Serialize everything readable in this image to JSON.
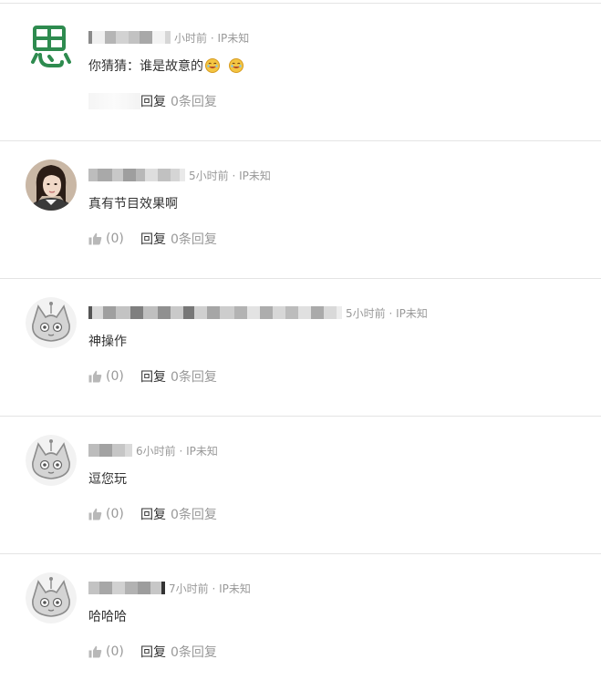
{
  "comments": [
    {
      "avatar": "si-character-icon",
      "time_ip": "小时前 · IP未知",
      "text": "你猜猜：谁是故意的",
      "emojis": [
        "laughing-emoji",
        "laughing-emoji"
      ],
      "like_count": "",
      "reply_label": "回复",
      "reply_count": "0条回复"
    },
    {
      "avatar": "woman-photo",
      "time_ip": "5小时前 · IP未知",
      "text": "真有节目效果啊",
      "emojis": [],
      "like_count": "(0)",
      "reply_label": "回复",
      "reply_count": "0条回复"
    },
    {
      "avatar": "default-cat-avatar-icon",
      "time_ip": "5小时前 · IP未知",
      "text": "神操作",
      "emojis": [],
      "like_count": "(0)",
      "reply_label": "回复",
      "reply_count": "0条回复"
    },
    {
      "avatar": "default-cat-avatar-icon",
      "time_ip": "6小时前 · IP未知",
      "text": "逗您玩",
      "emojis": [],
      "like_count": "(0)",
      "reply_label": "回复",
      "reply_count": "0条回复"
    },
    {
      "avatar": "default-cat-avatar-icon",
      "time_ip": "7小时前 · IP未知",
      "text": "哈哈哈",
      "emojis": [],
      "like_count": "(0)",
      "reply_label": "回复",
      "reply_count": "0条回复"
    }
  ],
  "colors": {
    "meta": "#999999",
    "text": "#333333",
    "divider": "#e4e4e4",
    "avatar_green": "#2e8b4f"
  }
}
